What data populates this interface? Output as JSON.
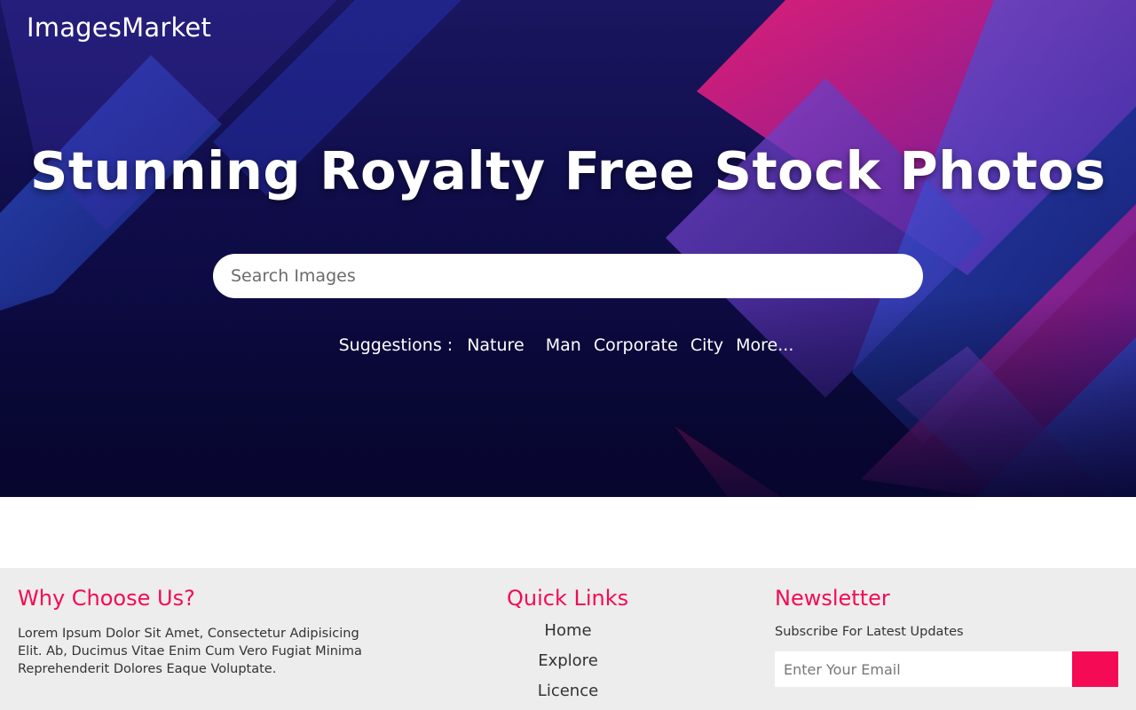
{
  "brand": {
    "logo": "ImagesMarket"
  },
  "hero": {
    "title": "Stunning Royalty Free Stock Photos",
    "search_placeholder": "Search Images",
    "suggestions_label": "Suggestions :",
    "suggestions": [
      "Nature",
      "Man",
      "Corporate",
      "City",
      "More..."
    ]
  },
  "footer": {
    "why": {
      "heading": "Why Choose Us?",
      "text": "Lorem Ipsum Dolor Sit Amet, Consectetur Adipisicing Elit. Ab, Ducimus Vitae Enim Cum Vero Fugiat Minima Reprehenderit Dolores Eaque Voluptate."
    },
    "quick_links": {
      "heading": "Quick Links",
      "items": [
        "Home",
        "Explore",
        "Licence"
      ]
    },
    "newsletter": {
      "heading": "Newsletter",
      "text": "Subscribe For Latest Updates",
      "email_placeholder": "Enter Your Email"
    }
  },
  "colors": {
    "accent": "#f50a55",
    "hero_dark": "#0f0c48",
    "footer_bg": "#ededed"
  }
}
